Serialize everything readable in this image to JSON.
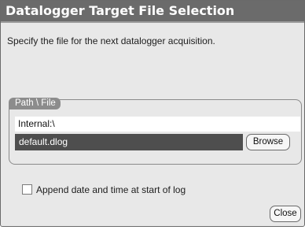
{
  "dialog": {
    "title": "Datalogger Target File Selection",
    "description": "Specify the file for the next datalogger acquisition."
  },
  "path_group": {
    "legend": "Path \\ File",
    "path": "Internal:\\",
    "file": "default.dlog",
    "browse_label": "Browse"
  },
  "options": {
    "append_label": "Append date and time at start of log",
    "append_checked": false
  },
  "footer": {
    "close_label": "Close"
  }
}
